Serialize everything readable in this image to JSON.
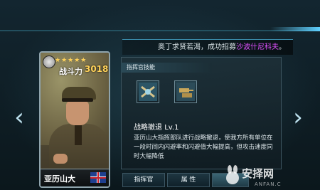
{
  "banner": {
    "text_prefix": "奥丁求贤若渴，成功招募",
    "highlight": "沙波什尼科夫",
    "text_suffix": "。"
  },
  "card": {
    "stars": "★★★★★",
    "power_label": "战斗力",
    "power_value": "3018",
    "name": "亚历山大"
  },
  "panel": {
    "tab_label": "指挥官技能",
    "skill_name": "战略撤退",
    "skill_level": "Lv.1",
    "skill_description": "亚历山大指挥部队进行战略撤退，使我方所有单位在一段时间内闪避率和闪避值大幅提高，但攻击速度同时大幅降低"
  },
  "tabs": [
    {
      "label": "指挥官"
    },
    {
      "label": "属 性"
    },
    {
      "label": ""
    }
  ],
  "watermark": {
    "text": "安择网",
    "sub": "ANFAN.C"
  },
  "colors": {
    "highlight": "#e050ff",
    "power": "#ffd25a",
    "accent": "#3a8aa8"
  }
}
